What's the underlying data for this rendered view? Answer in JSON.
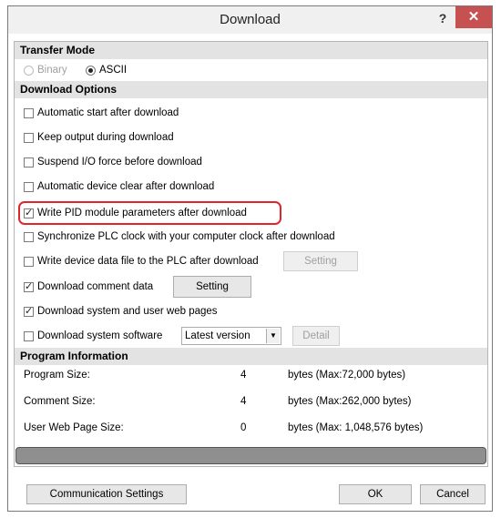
{
  "window": {
    "title": "Download",
    "help_label": "?",
    "close_label": "✕"
  },
  "transfer_mode": {
    "header": "Transfer Mode",
    "options": [
      {
        "label": "Binary",
        "checked": false,
        "disabled": true
      },
      {
        "label": "ASCII",
        "checked": true,
        "disabled": false
      }
    ]
  },
  "download_options": {
    "header": "Download Options",
    "items": [
      {
        "label": "Automatic start after download",
        "checked": false
      },
      {
        "label": "Keep output during download",
        "checked": false
      },
      {
        "label": "Suspend I/O force before download",
        "checked": false
      },
      {
        "label": "Automatic device clear after download",
        "checked": false
      },
      {
        "label": "Write PID module parameters after download",
        "checked": true
      },
      {
        "label": "Synchronize PLC clock with your computer clock after download",
        "checked": false
      },
      {
        "label": "Write device data file to the PLC after download",
        "checked": false
      },
      {
        "label": "Download comment data",
        "checked": true
      },
      {
        "label": "Download system and user web pages",
        "checked": true
      },
      {
        "label": "Download system software",
        "checked": false
      }
    ],
    "setting_label_1": "Setting",
    "setting_label_2": "Setting",
    "version_select_value": "Latest version",
    "detail_label": "Detail"
  },
  "program_information": {
    "header": "Program Information",
    "rows": [
      {
        "label": "Program Size:",
        "value": "4",
        "unit": "bytes (Max:72,000 bytes)"
      },
      {
        "label": "Comment Size:",
        "value": "4",
        "unit": "bytes (Max:262,000 bytes)"
      },
      {
        "label": "User Web Page Size:",
        "value": "0",
        "unit": "bytes (Max: 1,048,576 bytes)"
      }
    ]
  },
  "footer": {
    "communication_settings_label": "Communication Settings",
    "ok_label": "OK",
    "cancel_label": "Cancel"
  }
}
